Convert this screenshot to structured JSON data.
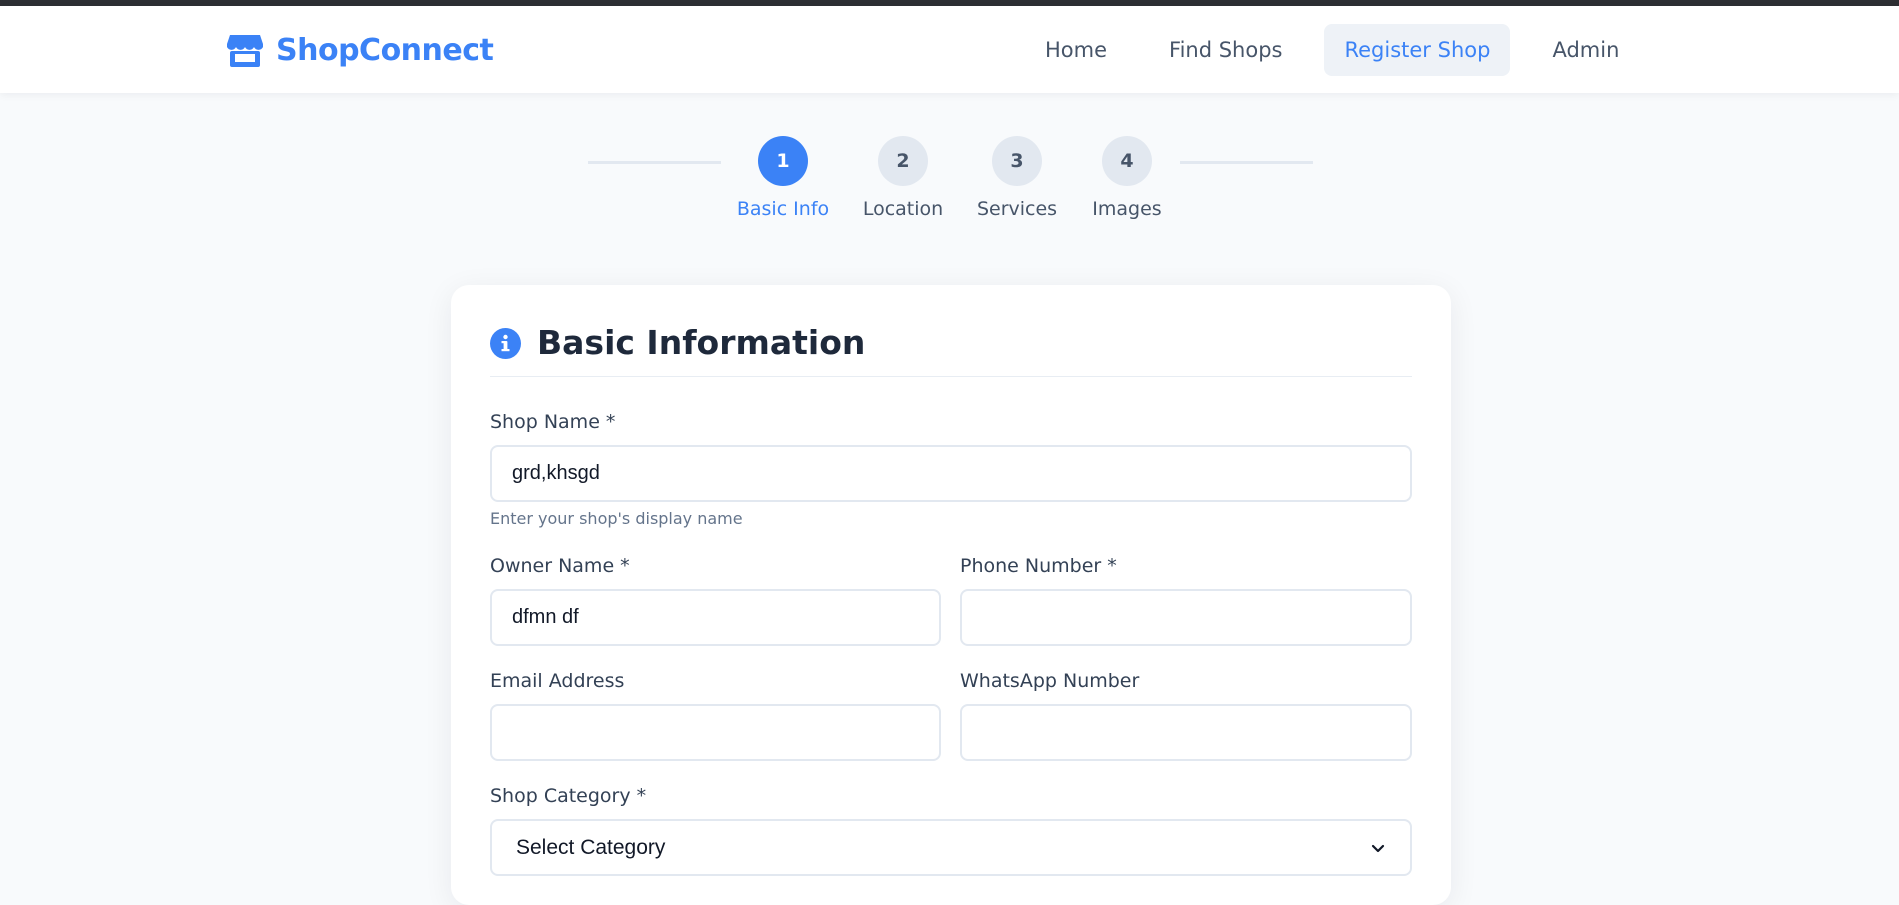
{
  "brand": {
    "name": "ShopConnect",
    "icon": "store-icon",
    "color": "#3b82f6"
  },
  "nav": {
    "items": [
      {
        "label": "Home",
        "active": false
      },
      {
        "label": "Find Shops",
        "active": false
      },
      {
        "label": "Register Shop",
        "active": true
      },
      {
        "label": "Admin",
        "active": false
      }
    ]
  },
  "stepper": {
    "steps": [
      {
        "number": "1",
        "label": "Basic Info",
        "active": true
      },
      {
        "number": "2",
        "label": "Location",
        "active": false
      },
      {
        "number": "3",
        "label": "Services",
        "active": false
      },
      {
        "number": "4",
        "label": "Images",
        "active": false
      }
    ]
  },
  "form": {
    "title": "Basic Information",
    "title_icon": "info-icon",
    "shop_name": {
      "label": "Shop Name *",
      "value": "grd,khsgd",
      "hint": "Enter your shop's display name"
    },
    "owner_name": {
      "label": "Owner Name *",
      "value": "dfmn df"
    },
    "phone": {
      "label": "Phone Number *",
      "value": ""
    },
    "email": {
      "label": "Email Address",
      "value": ""
    },
    "whatsapp": {
      "label": "WhatsApp Number",
      "value": ""
    },
    "category": {
      "label": "Shop Category *",
      "selected": "Select Category"
    }
  },
  "colors": {
    "accent": "#3b82f6",
    "page_bg": "#f8fafc",
    "muted": "#475569"
  }
}
